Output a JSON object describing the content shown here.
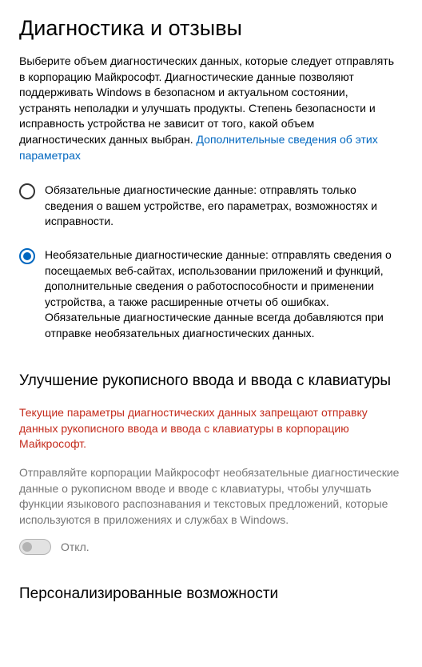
{
  "header": {
    "title": "Диагностика и отзывы"
  },
  "intro": {
    "text": "Выберите объем диагностических данных, которые следует отправлять в корпорацию Майкрософт. Диагностические данные позволяют поддерживать Windows в безопасном и актуальном состоянии, устранять неполадки и улучшать продукты. Степень безопасности и исправность устройства не зависит от того, какой объем диагностических данных выбран. ",
    "link": "Дополнительные сведения об этих параметрах"
  },
  "radio": {
    "option1": "Обязательные диагностические данные: отправлять только сведения о вашем устройстве, его параметрах, возможностях и исправности.",
    "option2": "Необязательные диагностические данные: отправлять сведения о посещаемых веб-сайтах, использовании приложений и функций, дополнительные сведения о работоспособности и применении устройства, а также расширенные отчеты об ошибках. Обязательные диагностические данные всегда добавляются при отправке необязательных диагностических данных."
  },
  "inking": {
    "title": "Улучшение рукописного ввода и ввода с клавиатуры",
    "warning": "Текущие параметры диагностических данных запрещают отправку данных рукописного ввода и ввода с клавиатуры в корпорацию Майкрософт.",
    "description": "Отправляйте корпорации Майкрософт необязательные диагностические данные о рукописном вводе и вводе с клавиатуры, чтобы улучшать функции языкового распознавания и текстовых предложений, которые используются в приложениях и службах в Windows.",
    "toggle_label": "Откл."
  },
  "personalization": {
    "title": "Персонализированные возможности"
  }
}
